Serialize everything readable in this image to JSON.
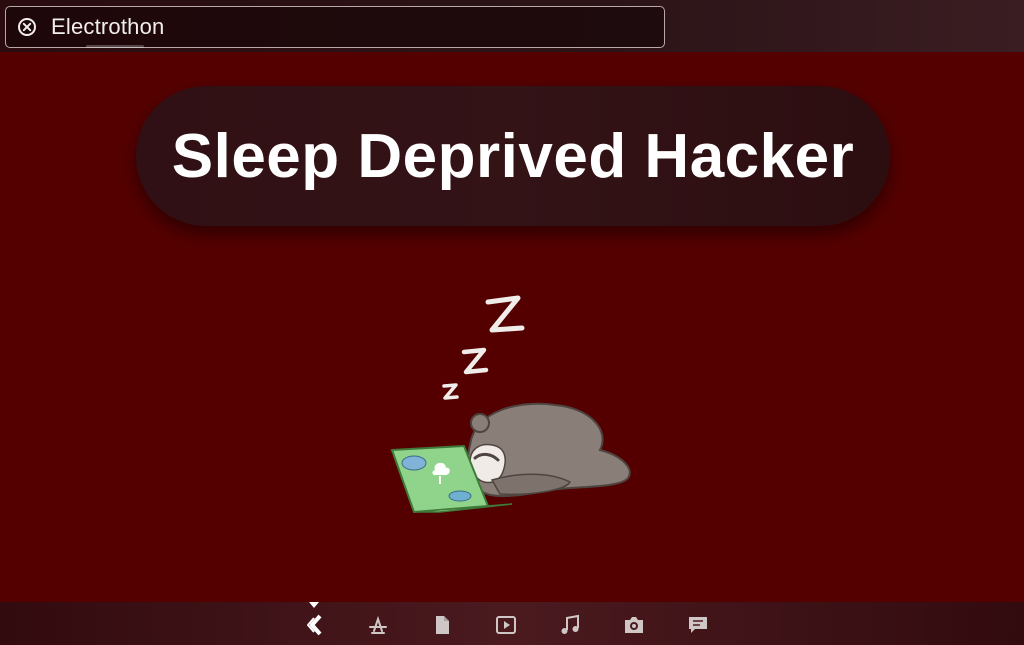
{
  "search_bar": {
    "value": "Electrothon",
    "close_icon": "close-circle-icon"
  },
  "headline": {
    "text": "Sleep Deprived Hacker"
  },
  "illustration": {
    "name": "sleeping-sloth-laptop",
    "zzz": "Z z z"
  },
  "dock": {
    "active_index": 0,
    "icons": [
      "launcher-icon",
      "app-store-icon",
      "document-icon",
      "video-icon",
      "music-icon",
      "camera-icon",
      "chat-icon"
    ]
  },
  "colors": {
    "background": "#540000",
    "laptop": "#8fd48a",
    "sloth": "#8a7e78"
  }
}
